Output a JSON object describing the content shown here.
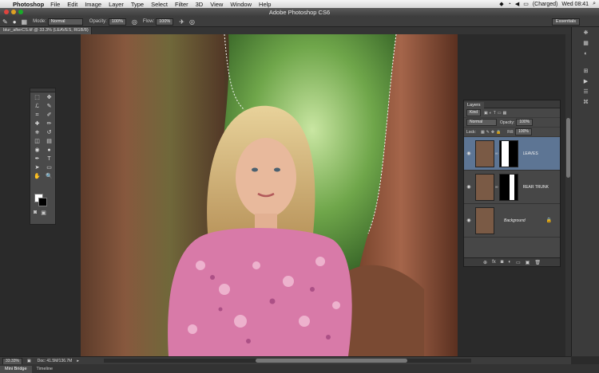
{
  "menubar": {
    "apple": "",
    "app": "Photoshop",
    "items": [
      "File",
      "Edit",
      "Image",
      "Layer",
      "Type",
      "Select",
      "Filter",
      "3D",
      "View",
      "Window",
      "Help"
    ],
    "battery": "(Charged)",
    "clock": "Wed 08:41"
  },
  "window": {
    "title": "Adobe Photoshop CS6"
  },
  "options": {
    "mode_label": "Mode:",
    "mode_value": "Normal",
    "opacity_label": "Opacity:",
    "opacity_value": "100%",
    "flow_label": "Flow:",
    "flow_value": "100%",
    "workspace": "Essentials"
  },
  "document": {
    "tab": "blur_afterCS.tif @ 33.3% (LEAVES, RGB/8) *"
  },
  "toolbox": {
    "tools": [
      "marquee-tool",
      "move-tool",
      "lasso-tool",
      "quick-select-tool",
      "crop-tool",
      "eyedropper-tool",
      "spot-heal-tool",
      "brush-tool",
      "clone-stamp-tool",
      "history-brush-tool",
      "eraser-tool",
      "gradient-tool",
      "blur-tool",
      "dodge-tool",
      "pen-tool",
      "type-tool",
      "path-select-tool",
      "shape-tool",
      "hand-tool",
      "zoom-tool"
    ],
    "glyphs": [
      "⬚",
      "✥",
      "ℒ",
      "✎",
      "⌗",
      "✐",
      "✚",
      "✏",
      "⎈",
      "↺",
      "◫",
      "▤",
      "◉",
      "●",
      "✒",
      "T",
      "➤",
      "▭",
      "✋",
      "🔍"
    ]
  },
  "layers_panel": {
    "tab": "Layers",
    "kind": "Kind",
    "blend": "Normal",
    "opacity_label": "Opacity:",
    "opacity": "100%",
    "lock_label": "Lock:",
    "fill_label": "Fill:",
    "fill": "100%",
    "layers": [
      {
        "name": "LEAVES",
        "selected": true
      },
      {
        "name": "REAR TRUNK",
        "selected": false
      },
      {
        "name": "Background",
        "selected": false
      }
    ],
    "footer_icons": [
      "⊕",
      "fx",
      "◙",
      "◐",
      "▭",
      "▣",
      "🗑"
    ]
  },
  "status": {
    "zoom": "33.33%",
    "doc": "Doc: 41.5M/136.7M"
  },
  "bottom_tabs": [
    "Mini Bridge",
    "Timeline"
  ],
  "colors": {
    "accent_selected_layer": "#5d7594",
    "foreground": "#ffffff",
    "background": "#000000"
  }
}
